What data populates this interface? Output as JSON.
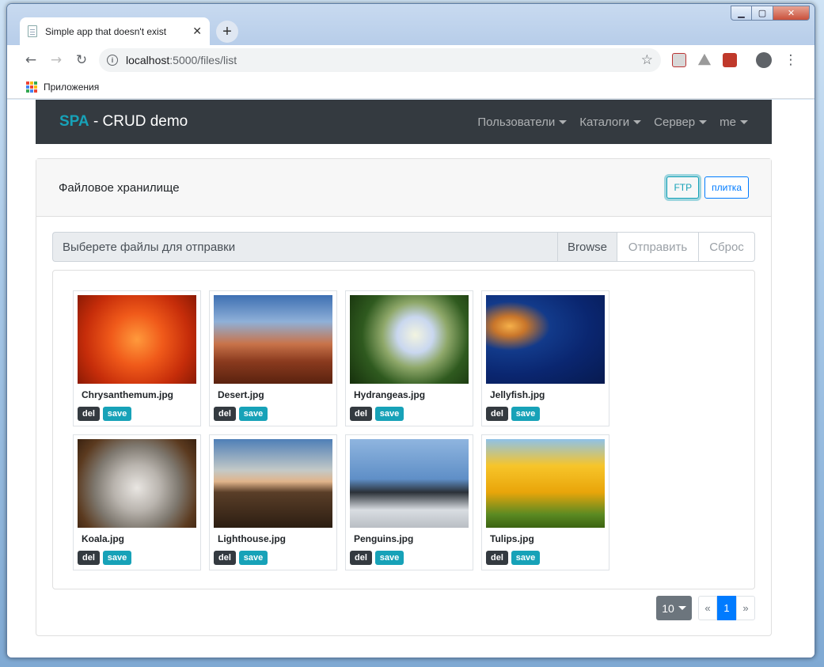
{
  "browser": {
    "tab_title": "Simple app that doesn't exist",
    "tab_close": "✕",
    "new_tab": "+",
    "url_host": "localhost",
    "url_path": ":5000/files/list",
    "bookmark_apps_label": "Приложения"
  },
  "window_controls": {
    "minimize": "▁",
    "maximize": "▢",
    "close": "✕"
  },
  "navbar": {
    "brand_accent": "SPA",
    "brand_rest": " - CRUD demo",
    "links": [
      "Пользователи",
      "Каталоги",
      "Сервер",
      "me"
    ]
  },
  "card": {
    "title": "Файловое хранилище",
    "ftp_button": "FTP",
    "tile_button": "плитка"
  },
  "upload": {
    "placeholder": "Выберете файлы для отправки",
    "browse_label": "Browse",
    "send_label": "Отправить",
    "reset_label": "Сброс"
  },
  "files": [
    {
      "name": "Chrysanthemum.jpg",
      "del": "del",
      "save": "save"
    },
    {
      "name": "Desert.jpg",
      "del": "del",
      "save": "save"
    },
    {
      "name": "Hydrangeas.jpg",
      "del": "del",
      "save": "save"
    },
    {
      "name": "Jellyfish.jpg",
      "del": "del",
      "save": "save"
    },
    {
      "name": "Koala.jpg",
      "del": "del",
      "save": "save"
    },
    {
      "name": "Lighthouse.jpg",
      "del": "del",
      "save": "save"
    },
    {
      "name": "Penguins.jpg",
      "del": "del",
      "save": "save"
    },
    {
      "name": "Tulips.jpg",
      "del": "del",
      "save": "save"
    }
  ],
  "pagination": {
    "per_page": "10",
    "prev": "«",
    "current": "1",
    "next": "»"
  },
  "colors": {
    "navbar": "#343a40",
    "accent": "#17a2b8",
    "primary": "#007bff"
  }
}
